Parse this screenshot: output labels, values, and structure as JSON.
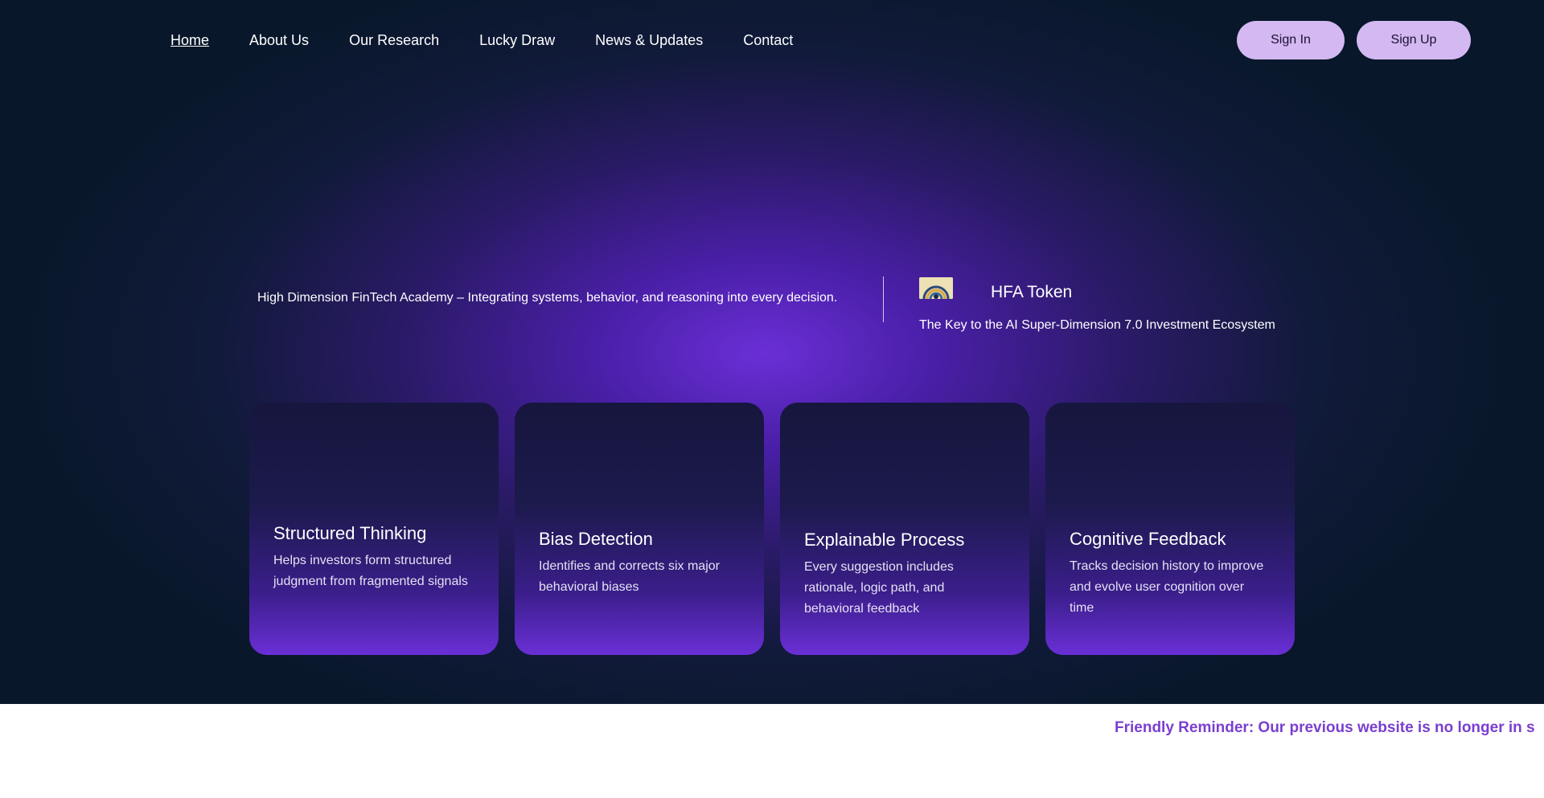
{
  "nav": {
    "items": [
      {
        "label": "Home",
        "active": true
      },
      {
        "label": "About Us"
      },
      {
        "label": "Our Research"
      },
      {
        "label": "Lucky Draw"
      },
      {
        "label": "News & Updates"
      },
      {
        "label": "Contact"
      }
    ],
    "sign_in": "Sign In",
    "sign_up": "Sign Up"
  },
  "hero": {
    "tagline": "High Dimension FinTech Academy – Integrating systems, behavior, and reasoning into every decision.",
    "token": {
      "logo": "hfa-token-logo",
      "title": "HFA Token",
      "subtitle": "The Key to the AI Super-Dimension 7.0 Investment Ecosystem"
    }
  },
  "cards": [
    {
      "title": "Structured Thinking",
      "text": "Helps investors form structured judgment from fragmented signals"
    },
    {
      "title": "Bias Detection",
      "text": "Identifies and corrects six major behavioral biases"
    },
    {
      "title": "Explainable Process",
      "text": "Every suggestion includes rationale, logic path, and behavioral feedback"
    },
    {
      "title": "Cognitive Feedback",
      "text": "Tracks decision history to improve and evolve user cognition over time"
    }
  ],
  "reminder": {
    "text": "Friendly Reminder: Our previous website is no longer in s"
  },
  "colors": {
    "accent": "#6a2fd6",
    "button_bg": "#d4b8f1",
    "reminder_text": "#7a3fd0",
    "page_bg": "#08172a"
  }
}
